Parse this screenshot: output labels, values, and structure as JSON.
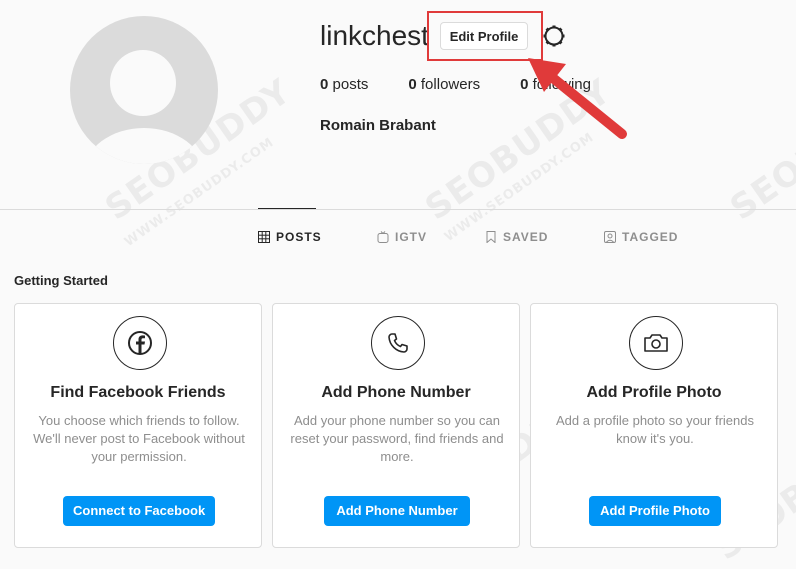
{
  "profile": {
    "username": "linkchest",
    "edit_label": "Edit Profile",
    "stats": [
      {
        "count": "0",
        "label": "posts"
      },
      {
        "count": "0",
        "label": "followers"
      },
      {
        "count": "0",
        "label": "following"
      }
    ],
    "full_name": "Romain Brabant"
  },
  "tabs": [
    {
      "label": "POSTS",
      "icon": "grid-icon",
      "active": true
    },
    {
      "label": "IGTV",
      "icon": "igtv-icon",
      "active": false
    },
    {
      "label": "SAVED",
      "icon": "bookmark-icon",
      "active": false
    },
    {
      "label": "TAGGED",
      "icon": "tag-icon",
      "active": false
    }
  ],
  "getting_started": {
    "title": "Getting Started",
    "cards": [
      {
        "icon": "facebook-icon",
        "title": "Find Facebook Friends",
        "description": "You choose which friends to follow. We'll never post to Facebook without your permission.",
        "button": "Connect to Facebook"
      },
      {
        "icon": "phone-icon",
        "title": "Add Phone Number",
        "description": "Add your phone number so you can reset your password, find friends and more.",
        "button": "Add Phone Number"
      },
      {
        "icon": "camera-icon",
        "title": "Add Profile Photo",
        "description": "Add a profile photo so your friends know it's you.",
        "button": "Add Profile Photo"
      }
    ]
  },
  "watermark": {
    "brand": "SEOBUDDY",
    "url": "WWW.SEOBUDDY.COM"
  },
  "colors": {
    "primary_button": "#0095f6",
    "highlight": "#e03a3a"
  }
}
